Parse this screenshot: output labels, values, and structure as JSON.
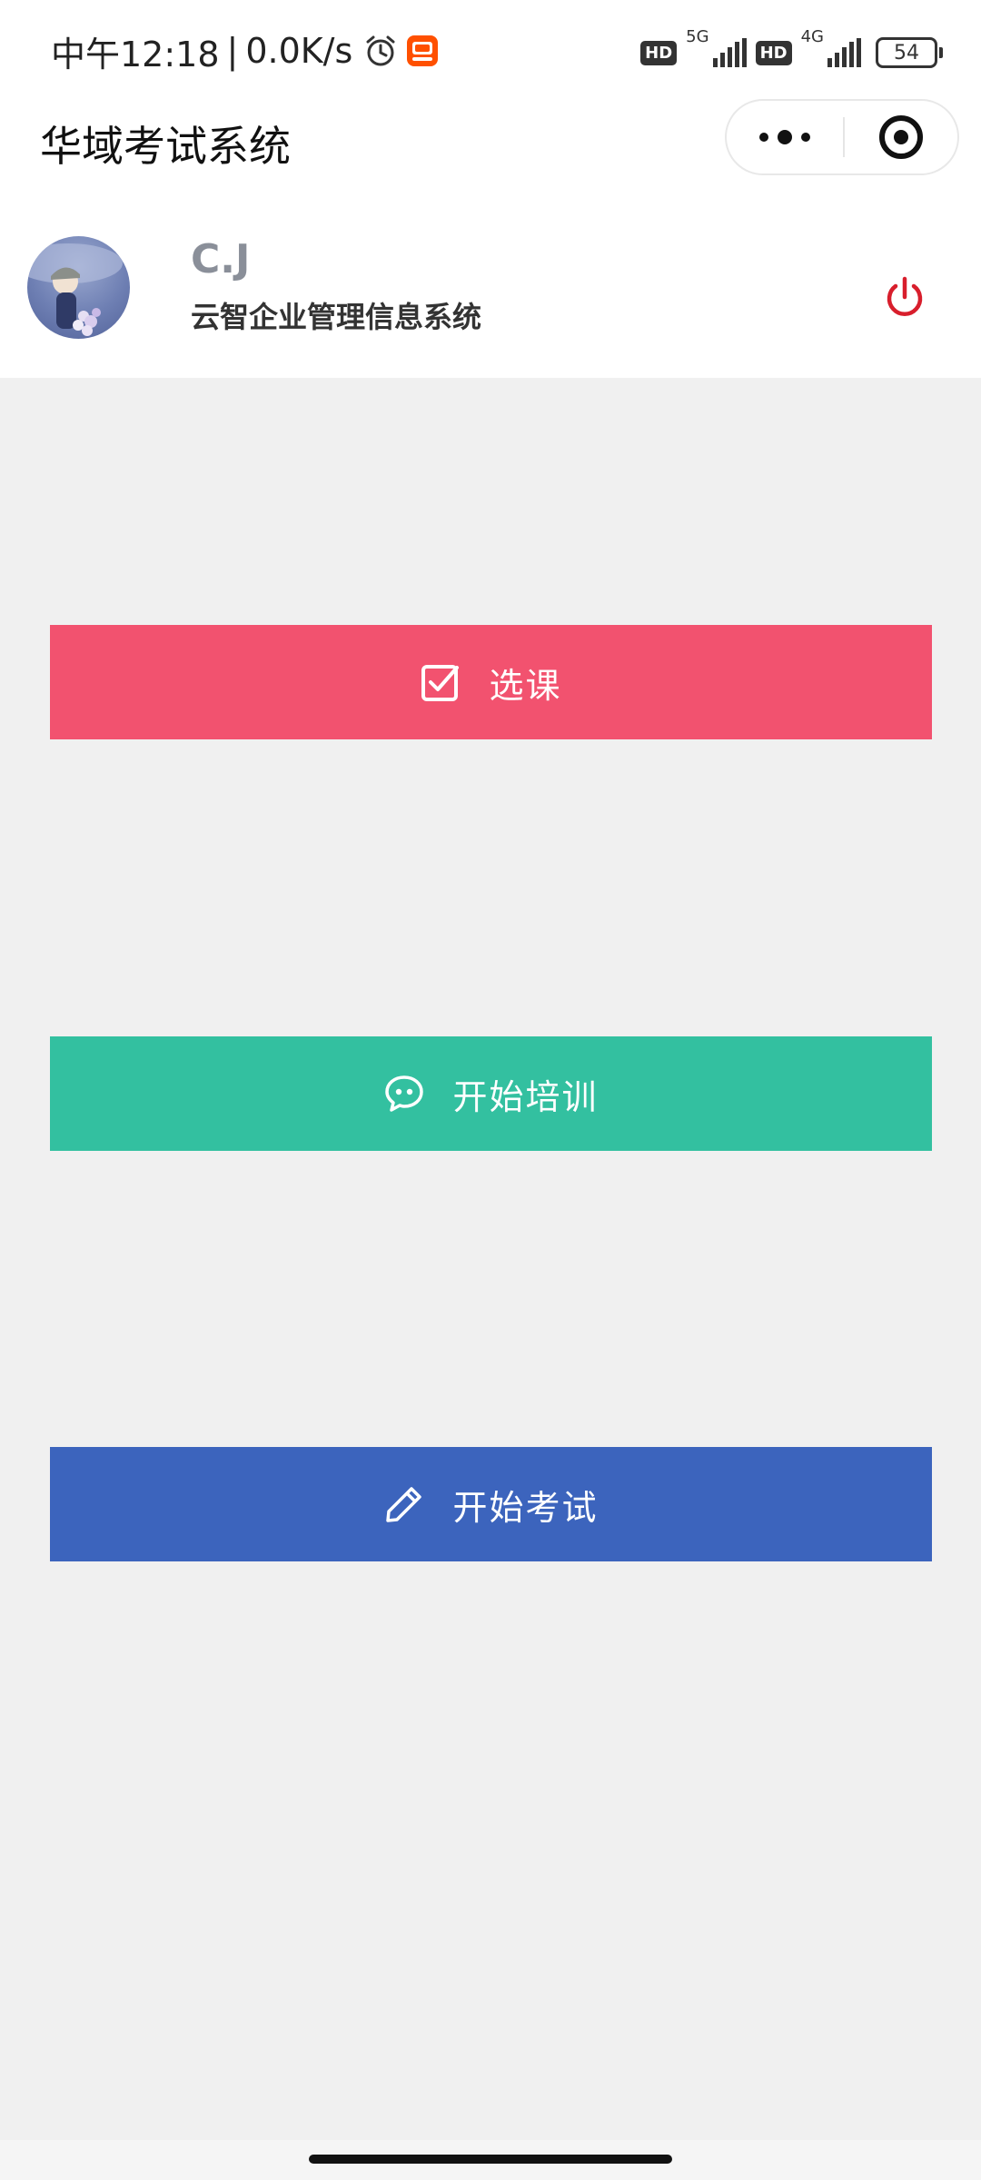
{
  "status_bar": {
    "time": "中午12:18",
    "separator": "|",
    "speed": "0.0K/s",
    "icons": [
      "alarm-icon",
      "taobao-app-icon"
    ],
    "hd1": "HD",
    "net1": "5G",
    "hd2": "HD",
    "net2": "4G",
    "battery": "54"
  },
  "nav": {
    "title": "华域考试系统",
    "more_icon": "more-dots-icon",
    "close_icon": "close-miniprogram-icon"
  },
  "profile": {
    "avatar": "avatar-image",
    "name": "C.J",
    "company": "云智企业管理信息系统",
    "logout_icon": "power-icon",
    "logout_color": "#d81e2c"
  },
  "actions": [
    {
      "label": "选课",
      "icon": "checkbox-icon",
      "color": "#f2526f"
    },
    {
      "label": "开始培训",
      "icon": "chat-bubble-icon",
      "color": "#33c0a0"
    },
    {
      "label": "开始考试",
      "icon": "pencil-icon",
      "color": "#3c64bd"
    }
  ],
  "colors": {
    "page_background": "#f0f0f0",
    "header_background": "#ffffff"
  }
}
